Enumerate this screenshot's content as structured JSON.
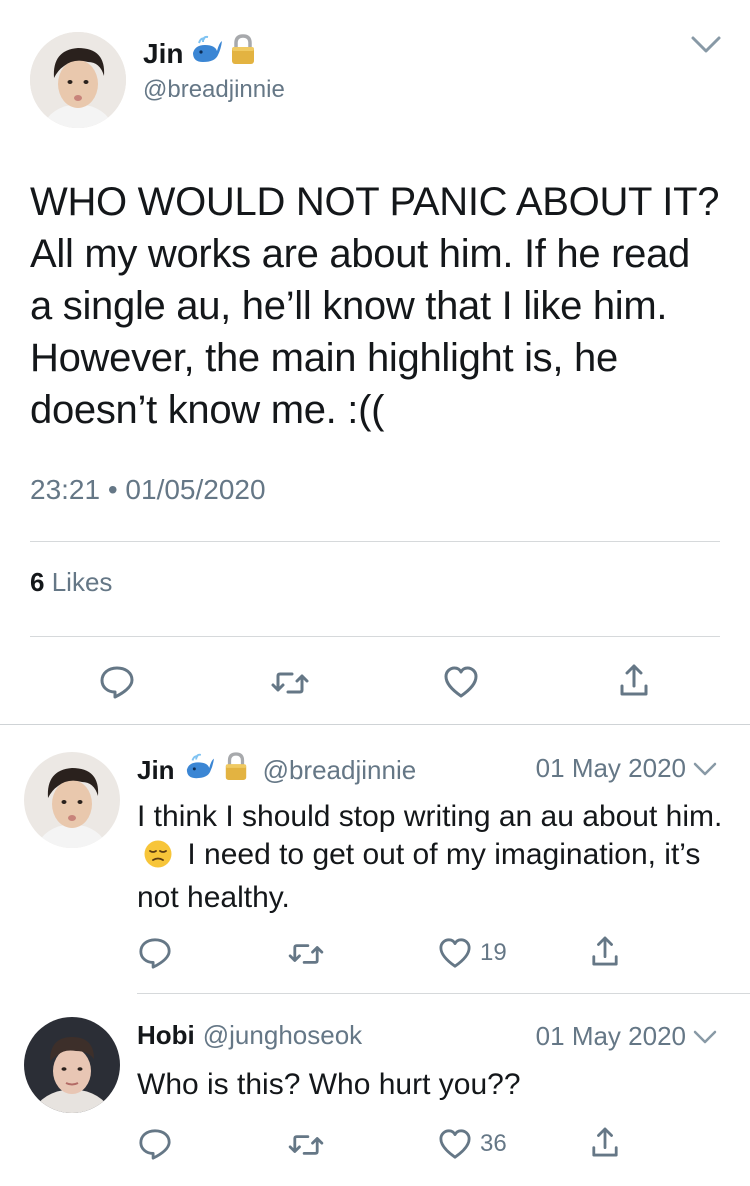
{
  "main_tweet": {
    "name": "Jin",
    "handle": "@breadjinnie",
    "text": "WHO WOULD NOT PANIC ABOUT IT? All my works are about him. If he read a single au, he’ll know that I like him. However, the main highlight is, he doesn’t know me. :((",
    "timestamp": "23:21 • 01/05/2020",
    "likes_count": "6",
    "likes_label": "Likes"
  },
  "replies": [
    {
      "name": "Jin",
      "handle": "@breadjinnie",
      "date": "01 May 2020",
      "text_part1": "I think I should stop writing an au about him.",
      "text_part2": "I need to get out of my imagination, it’s not healthy.",
      "like_count": "19"
    },
    {
      "name": "Hobi",
      "handle": "@junghoseok",
      "date": "01 May 2020",
      "text": "Who is this? Who hurt you??",
      "like_count": "36"
    }
  ],
  "icons": [
    "whale-emoji-icon",
    "lock-emoji-icon",
    "chevron-down-icon",
    "reply-icon",
    "retweet-icon",
    "heart-icon",
    "share-icon",
    "pensive-face-emoji-icon"
  ],
  "colors": {
    "text": "#14171a",
    "secondary": "#657786",
    "divider": "#d6d9db"
  }
}
